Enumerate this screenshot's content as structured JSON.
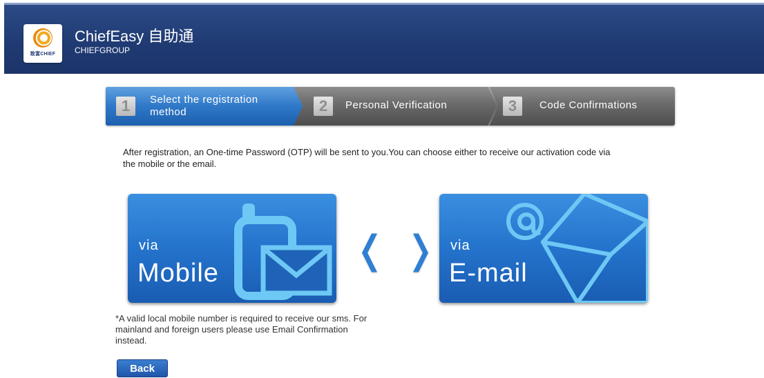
{
  "header": {
    "logo_text": "致富CHIEF",
    "app_title": "ChiefEasy 自助通",
    "app_subtitle": "CHIEFGROUP"
  },
  "steps": [
    {
      "number": "1",
      "label": "Select the registration method",
      "active": true
    },
    {
      "number": "2",
      "label": "Personal Verification",
      "active": false
    },
    {
      "number": "3",
      "label": "Code Confirmations",
      "active": false
    }
  ],
  "intro_text": "After registration, an One-time Password (OTP) will be sent to you.You can choose either to receive our activation code via the mobile or the email.",
  "options": {
    "mobile": {
      "prefix": "via",
      "label": "Mobile",
      "icon": "mobile-envelope-icon"
    },
    "email": {
      "prefix": "via",
      "label": "E-mail",
      "icon": "at-envelope-icon"
    }
  },
  "nav_glyphs": {
    "left": "❬",
    "right": "❭"
  },
  "note_text": "*A valid local mobile number is required to receive our sms. For mainland and foreign users please use Email Confirmation instead.",
  "back_label": "Back",
  "colors": {
    "header": "#1f3a72",
    "accent": "#2473cc",
    "step_inactive": "#6a6a6a"
  }
}
